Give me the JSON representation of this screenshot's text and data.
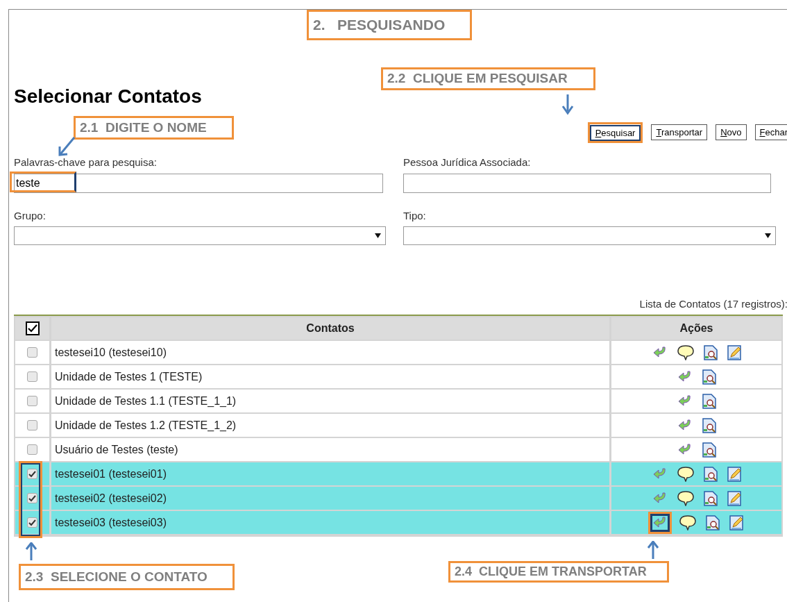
{
  "title": "Selecionar Contatos",
  "buttons": [
    {
      "label": "Pesquisar",
      "highlighted": true
    },
    {
      "label": "Transportar",
      "highlighted": false
    },
    {
      "label": "Novo",
      "highlighted": false
    },
    {
      "label": "Fechar",
      "highlighted": false
    }
  ],
  "fields": [
    {
      "label": "Palavras-chave para pesquisa:",
      "kind": "text",
      "value": "teste",
      "highlighted": true
    },
    {
      "label": "Pessoa Jurídica Associada:",
      "kind": "text",
      "highlighted": false
    },
    {
      "label": "Grupo:",
      "kind": "select",
      "highlighted": false
    },
    {
      "label": "Tipo:",
      "kind": "select",
      "highlighted": false
    }
  ],
  "list_caption": "Lista de Contatos (17 registros):",
  "table": {
    "select_all": {
      "checked": true
    },
    "columns": [
      "Contatos",
      "Ações"
    ],
    "rows": [
      {
        "name": "testesei10 (testesei10)",
        "selected": false,
        "actions": [
          {
            "kind": "transport",
            "highlighted": false
          },
          {
            "kind": "note",
            "highlighted": false
          },
          {
            "kind": "view",
            "highlighted": false
          },
          {
            "kind": "edit",
            "highlighted": false
          }
        ]
      },
      {
        "name": "Unidade de Testes 1 (TESTE)",
        "selected": false,
        "actions": [
          {
            "kind": "transport",
            "highlighted": false
          },
          {
            "kind": "view",
            "highlighted": false
          }
        ]
      },
      {
        "name": "Unidade de Testes 1.1 (TESTE_1_1)",
        "selected": false,
        "actions": [
          {
            "kind": "transport",
            "highlighted": false
          },
          {
            "kind": "view",
            "highlighted": false
          }
        ]
      },
      {
        "name": "Unidade de Testes 1.2 (TESTE_1_2)",
        "selected": false,
        "actions": [
          {
            "kind": "transport",
            "highlighted": false
          },
          {
            "kind": "view",
            "highlighted": false
          }
        ]
      },
      {
        "name": "Usuário de Testes (teste)",
        "selected": false,
        "actions": [
          {
            "kind": "transport",
            "highlighted": false
          },
          {
            "kind": "view",
            "highlighted": false
          }
        ]
      },
      {
        "name": "testesei01 (testesei01)",
        "selected": true,
        "actions": [
          {
            "kind": "transport",
            "highlighted": false
          },
          {
            "kind": "note",
            "highlighted": false
          },
          {
            "kind": "view",
            "highlighted": false
          },
          {
            "kind": "edit",
            "highlighted": false
          }
        ]
      },
      {
        "name": "testesei02 (testesei02)",
        "selected": true,
        "actions": [
          {
            "kind": "transport",
            "highlighted": false
          },
          {
            "kind": "note",
            "highlighted": false
          },
          {
            "kind": "view",
            "highlighted": false
          },
          {
            "kind": "edit",
            "highlighted": false
          }
        ]
      },
      {
        "name": "testesei03 (testesei03)",
        "selected": true,
        "actions": [
          {
            "kind": "transport",
            "highlighted": true
          },
          {
            "kind": "note",
            "highlighted": false
          },
          {
            "kind": "view",
            "highlighted": false
          },
          {
            "kind": "edit",
            "highlighted": false
          }
        ]
      }
    ]
  },
  "callouts": [
    {
      "text": "2.   PESQUISANDO"
    },
    {
      "text": "2.2  CLIQUE EM PESQUISAR"
    },
    {
      "text": "2.1  DIGITE O NOME"
    },
    {
      "text": "2.3  SELECIONE O CONTATO"
    },
    {
      "text": "2.4  CLIQUE EM TRANSPORTAR"
    }
  ]
}
